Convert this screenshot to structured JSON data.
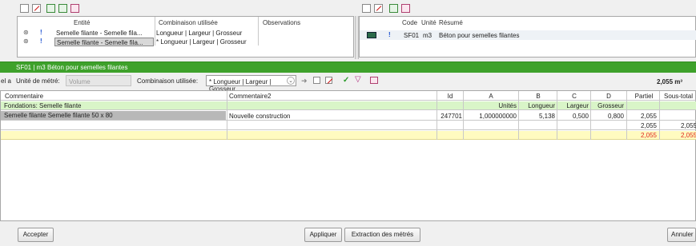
{
  "top_left": {
    "headers": {
      "entite": "Entité",
      "combinaison": "Combinaison utilisée",
      "observations": "Observations"
    },
    "rows": [
      {
        "marker": "!",
        "entite": "Semelle filante - Semelle fila...",
        "combinaison": "Longueur | Largeur | Grosseur"
      },
      {
        "marker": "!",
        "entite": "Semelle filante - Semelle fila...",
        "combinaison": "* Longueur | Largeur | Grosseur"
      }
    ]
  },
  "top_right": {
    "headers": {
      "code": "Code",
      "unite": "Unité",
      "resume": "Résumé"
    },
    "rows": [
      {
        "marker": "!",
        "code": "SF01",
        "unite": "m3",
        "resume": "Béton pour semelles filantes"
      }
    ]
  },
  "green_bar": {
    "title": "SF01 | m3 Béton pour semelles filantes"
  },
  "options": {
    "left_clip": "el a",
    "unite_label": "Unité de métré:",
    "unite_value": "Volume",
    "combinaison_label": "Combinaison utilisée:",
    "combinaison_value": "* Longueur | Largeur | Grosseur",
    "total": "2,055 m³"
  },
  "grid": {
    "headers": {
      "commentaire": "Commentaire",
      "commentaire2": "Commentaire2",
      "id": "Id",
      "a": "A",
      "b": "B",
      "c": "C",
      "d": "D",
      "partiel": "Partiel",
      "sous_total": "Sous-total"
    },
    "group_row": {
      "label": "Fondations: Semelle filante",
      "a": "Unités",
      "b": "Longueur",
      "c": "Largeur",
      "d": "Grosseur"
    },
    "data_row": {
      "commentaire": "Semelle filante Semelle filante 50 x 80",
      "commentaire2": "Nouvelle construction",
      "id": "247701",
      "a": "1,000000000",
      "b": "5,138",
      "c": "0,500",
      "d": "0,800",
      "partiel": "2,055"
    },
    "subtotal_row": {
      "partiel": "2,055",
      "sous_total": "2,055"
    },
    "total_row": {
      "partiel": "2,055",
      "sous_total": "2,055"
    }
  },
  "buttons": {
    "accepter": "Accepter",
    "appliquer": "Appliquer",
    "extraction": "Extraction des métrés",
    "annuler": "Annuler"
  },
  "colors": {
    "green": "#3ea12b",
    "light_green": "#d9f5c8",
    "yellow": "#fffbc0",
    "red_text": "#e0281e"
  }
}
